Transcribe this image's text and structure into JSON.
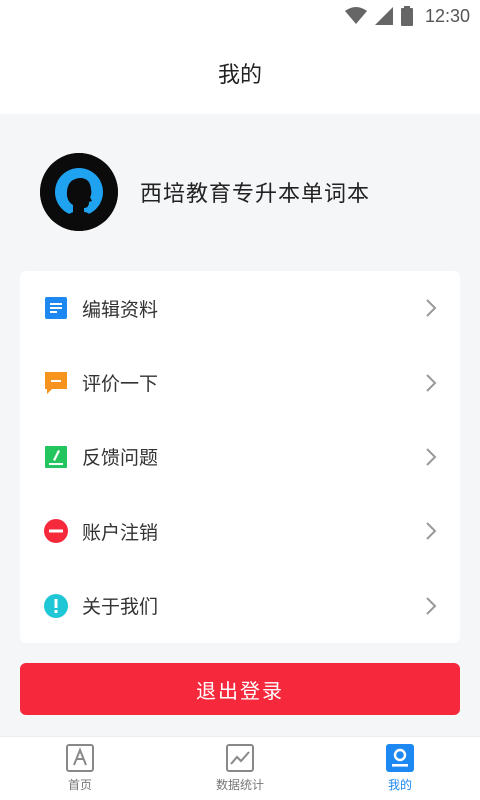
{
  "status_bar": {
    "time": "12:30"
  },
  "header": {
    "title": "我的"
  },
  "profile": {
    "name": "西培教育专升本单词本"
  },
  "menu": {
    "items": [
      {
        "label": "编辑资料",
        "icon": "edit-profile-icon",
        "color": "#1e88f2"
      },
      {
        "label": "评价一下",
        "icon": "comment-icon",
        "color": "#f7941d"
      },
      {
        "label": "反馈问题",
        "icon": "feedback-icon",
        "color": "#22c55e"
      },
      {
        "label": "账户注销",
        "icon": "cancel-account-icon",
        "color": "#f5283c"
      },
      {
        "label": "关于我们",
        "icon": "about-icon",
        "color": "#1fc6d6"
      }
    ]
  },
  "logout": {
    "label": "退出登录",
    "color": "#f5283c"
  },
  "tabs": [
    {
      "label": "首页",
      "icon": "home-tab-icon",
      "active": false
    },
    {
      "label": "数据统计",
      "icon": "stats-tab-icon",
      "active": false
    },
    {
      "label": "我的",
      "icon": "profile-tab-icon",
      "active": true
    }
  ],
  "colors": {
    "accent": "#1e88f2",
    "danger": "#f5283c",
    "background": "#f5f6f8"
  }
}
